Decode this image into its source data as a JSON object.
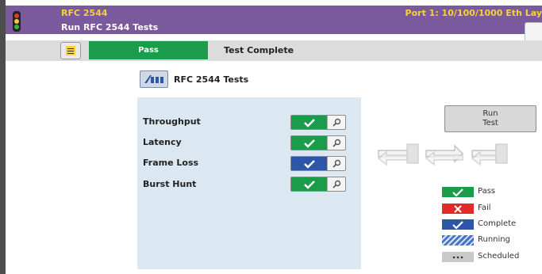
{
  "app": {
    "title_left": "RFC 2544",
    "title_right": "Port 1: 10/100/1000 Eth Lay",
    "subtitle": "Run RFC 2544 Tests"
  },
  "status": {
    "result": "Pass",
    "state": "Test Complete"
  },
  "suite_title": "RFC 2544 Tests",
  "tests": [
    {
      "label": "Throughput",
      "status": "pass",
      "color": "#1a9c4a"
    },
    {
      "label": "Latency",
      "status": "pass",
      "color": "#1a9c4a"
    },
    {
      "label": "Frame Loss",
      "status": "complete",
      "color": "#2e56a8"
    },
    {
      "label": "Burst Hunt",
      "status": "pass",
      "color": "#1a9c4a"
    }
  ],
  "run_button": {
    "line1": "Run",
    "line2": "Test"
  },
  "legend": [
    {
      "label": "Pass",
      "color": "#1a9c4a",
      "icon": "check-icon"
    },
    {
      "label": "Fail",
      "color": "#e32a2a",
      "icon": "x-icon"
    },
    {
      "label": "Complete",
      "color": "#2e56a8",
      "icon": "check-icon"
    },
    {
      "label": "Running",
      "color": "#4a74c8",
      "icon": "hatch-icon"
    },
    {
      "label": "Scheduled",
      "color": "#c9c9c9",
      "icon": "dots-icon"
    }
  ]
}
